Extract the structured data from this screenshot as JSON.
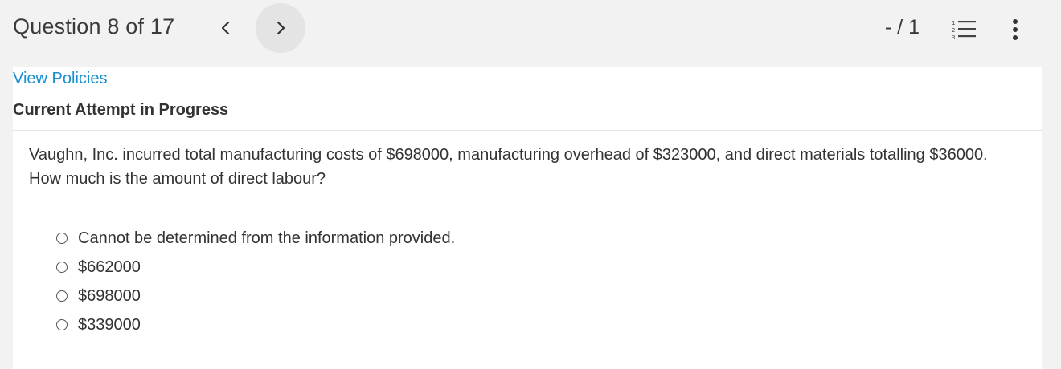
{
  "header": {
    "question_counter": "Question 8 of 17",
    "prev_icon": "chevron-left-icon",
    "next_icon": "chevron-right-icon",
    "score": "- / 1",
    "list_icon": "numbered-list-icon",
    "more_icon": "more-vertical-icon"
  },
  "links": {
    "view_policies": "View Policies"
  },
  "status": {
    "attempt": "Current Attempt in Progress"
  },
  "question": {
    "text": "Vaughn, Inc. incurred total manufacturing costs of $698000, manufacturing overhead of $323000, and direct materials totalling $36000. How much is the amount of direct labour?"
  },
  "options": [
    {
      "label": "Cannot be determined from the information provided."
    },
    {
      "label": "$662000"
    },
    {
      "label": "$698000"
    },
    {
      "label": "$339000"
    }
  ],
  "colors": {
    "link": "#1a8fd1",
    "header_bg": "#f2f2f2",
    "active_nav_bg": "#e4e4e4"
  }
}
